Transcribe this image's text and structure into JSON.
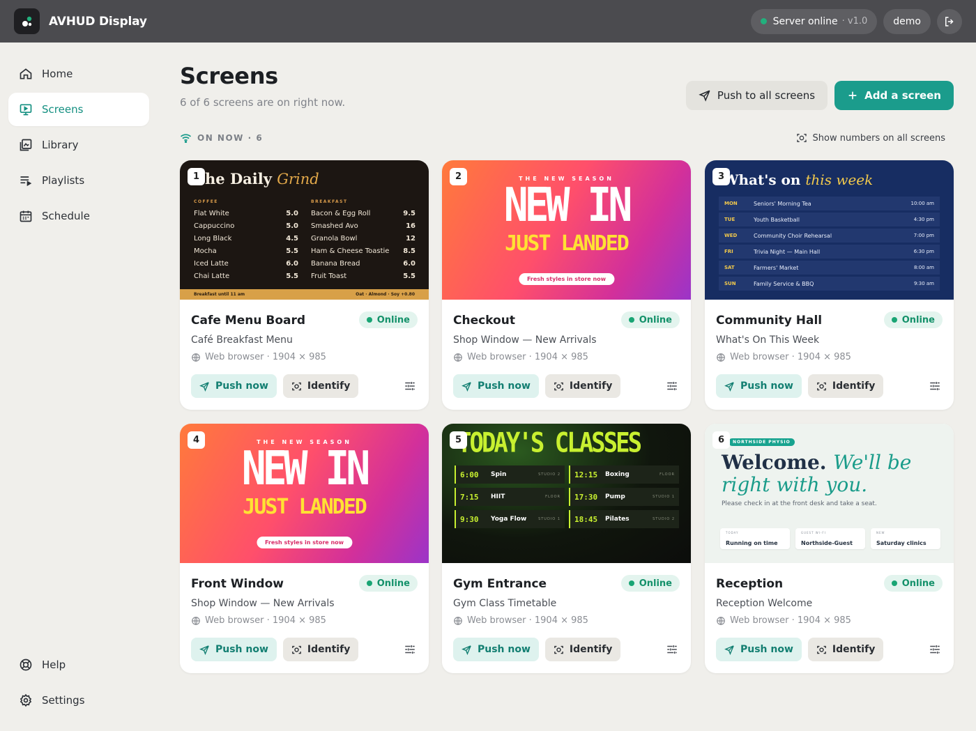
{
  "app": {
    "title": "AVHUD Display"
  },
  "topbar": {
    "server_status": "Server online",
    "version": "· v1.0",
    "user": "demo"
  },
  "sidebar": {
    "items": [
      {
        "label": "Home",
        "icon": "home-icon"
      },
      {
        "label": "Screens",
        "icon": "monitor-icon",
        "active": true
      },
      {
        "label": "Library",
        "icon": "library-icon"
      },
      {
        "label": "Playlists",
        "icon": "playlist-icon"
      },
      {
        "label": "Schedule",
        "icon": "calendar-icon"
      }
    ],
    "bottom": [
      {
        "label": "Help",
        "icon": "lifebuoy-icon"
      },
      {
        "label": "Settings",
        "icon": "gear-icon"
      }
    ]
  },
  "header": {
    "title": "Screens",
    "subtitle": "6 of 6 screens are on right now.",
    "push_all_label": "Push to all screens",
    "add_label": "Add a screen"
  },
  "section": {
    "on_now_label": "ON NOW · 6",
    "show_numbers_label": "Show numbers on all screens"
  },
  "colors": {
    "accent": "#1b9c8c",
    "online": "#19a574",
    "topbar": "#4b4b4f",
    "background": "#f0efeb"
  },
  "card_actions": {
    "push": "Push now",
    "identify": "Identify"
  },
  "screens": [
    {
      "number": "1",
      "name": "Cafe Menu Board",
      "status": "Online",
      "playlist": "Café Breakfast Menu",
      "meta": "Web browser · 1904 × 985"
    },
    {
      "number": "2",
      "name": "Checkout",
      "status": "Online",
      "playlist": "Shop Window — New Arrivals",
      "meta": "Web browser · 1904 × 985"
    },
    {
      "number": "3",
      "name": "Community Hall",
      "status": "Online",
      "playlist": "What's On This Week",
      "meta": "Web browser · 1904 × 985"
    },
    {
      "number": "4",
      "name": "Front Window",
      "status": "Online",
      "playlist": "Shop Window — New Arrivals",
      "meta": "Web browser · 1904 × 985"
    },
    {
      "number": "5",
      "name": "Gym Entrance",
      "status": "Online",
      "playlist": "Gym Class Timetable",
      "meta": "Web browser · 1904 × 985"
    },
    {
      "number": "6",
      "name": "Reception",
      "status": "Online",
      "playlist": "Reception Welcome",
      "meta": "Web browser · 1904 × 985"
    }
  ],
  "previews": {
    "cafe": {
      "title_a": "he Daily ",
      "title_b": "Grind",
      "coffee_head": "COFFEE",
      "breakfast_head": "BREAKFAST",
      "coffee": [
        [
          "Flat White",
          "5.0"
        ],
        [
          "Cappuccino",
          "5.0"
        ],
        [
          "Long Black",
          "4.5"
        ],
        [
          "Mocha",
          "5.5"
        ],
        [
          "Iced Latte",
          "6.0"
        ],
        [
          "Chai Latte",
          "5.5"
        ]
      ],
      "breakfast": [
        [
          "Bacon & Egg Roll",
          "9.5"
        ],
        [
          "Smashed Avo",
          "16"
        ],
        [
          "Granola Bowl",
          "12"
        ],
        [
          "Ham & Cheese Toastie",
          "8.5"
        ],
        [
          "Banana Bread",
          "6.0"
        ],
        [
          "Fruit Toast",
          "5.5"
        ]
      ],
      "foot_left": "Breakfast until 11 am",
      "foot_right": "Oat · Almond · Soy +0.80"
    },
    "shop": {
      "sup": "THE NEW SEASON",
      "big": "NEW IN",
      "yellow": "JUST LANDED",
      "chip": "Fresh styles in store now"
    },
    "hall": {
      "title_a": "What's on ",
      "title_b": "this week",
      "rows": [
        [
          "MON",
          "Seniors' Morning Tea",
          "10:00 am"
        ],
        [
          "TUE",
          "Youth Basketball",
          "4:30 pm"
        ],
        [
          "WED",
          "Community Choir Rehearsal",
          "7:00 pm"
        ],
        [
          "FRI",
          "Trivia Night — Main Hall",
          "6:30 pm"
        ],
        [
          "SAT",
          "Farmers' Market",
          "8:00 am"
        ],
        [
          "SUN",
          "Family Service & BBQ",
          "9:30 am"
        ]
      ]
    },
    "gym": {
      "title_a": "TODAY'S ",
      "title_b": "CLASSES",
      "classes": [
        [
          "6:00",
          "Spin",
          "STUDIO 2"
        ],
        [
          "12:15",
          "Boxing",
          "FLOOR"
        ],
        [
          "7:15",
          "HIIT",
          "FLOOR"
        ],
        [
          "17:30",
          "Pump",
          "STUDIO 1"
        ],
        [
          "9:30",
          "Yoga Flow",
          "STUDIO 1"
        ],
        [
          "18:45",
          "Pilates",
          "STUDIO 2"
        ]
      ]
    },
    "reception": {
      "tag": "NORTHSIDE PHYSIO",
      "title_a": "Welcome. ",
      "title_b": "We'll be right with you.",
      "note": "Please check in at the front desk and take a seat.",
      "chips": [
        [
          "TODAY",
          "Running on time"
        ],
        [
          "GUEST WI-FI",
          "Northside-Guest"
        ],
        [
          "NEW",
          "Saturday clinics"
        ]
      ]
    }
  }
}
